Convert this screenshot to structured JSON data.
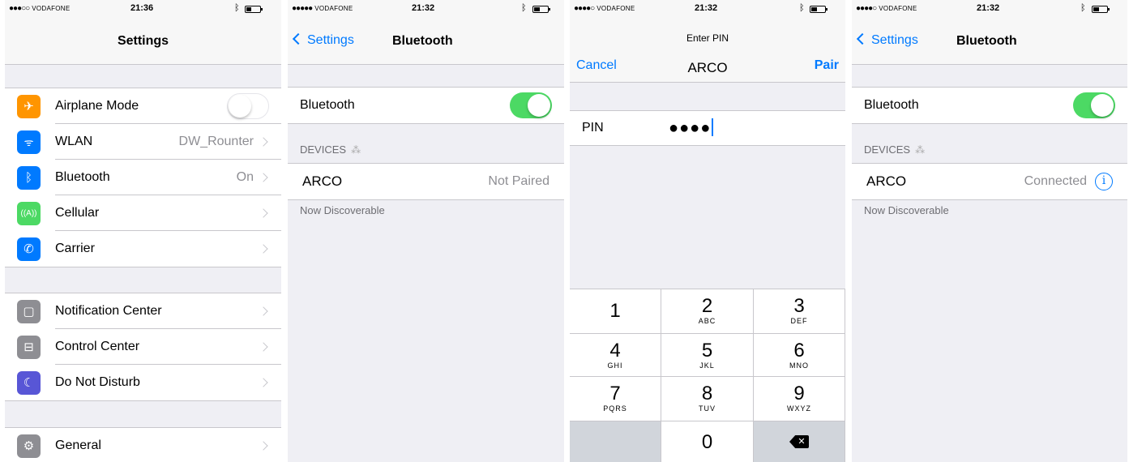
{
  "colors": {
    "accent": "#007aff",
    "toggle_on": "#4cd964",
    "group_bg": "#efeff4"
  },
  "screens": [
    {
      "status": {
        "carrier": "VODAFONE",
        "time": "21:36"
      },
      "nav": {
        "title": "Settings"
      },
      "rows": [
        {
          "label": "Airplane Mode",
          "icon": "airplane-icon",
          "color": "#ff9500",
          "glyph": "✈",
          "toggle": "off"
        },
        {
          "label": "WLAN",
          "icon": "wifi-icon",
          "color": "#007aff",
          "glyph": "≋",
          "value": "DW_Rounter"
        },
        {
          "label": "Bluetooth",
          "icon": "bluetooth-icon",
          "color": "#007aff",
          "glyph": "ᛒ",
          "value": "On"
        },
        {
          "label": "Cellular",
          "icon": "cellular-icon",
          "color": "#4cd964",
          "glyph": "((ᴬ))"
        },
        {
          "label": "Carrier",
          "icon": "phone-icon",
          "color": "#007aff",
          "glyph": "✆"
        },
        {
          "label": "Notification Center",
          "icon": "notification-icon",
          "color": "#8e8e93",
          "glyph": "▢"
        },
        {
          "label": "Control Center",
          "icon": "control-center-icon",
          "color": "#8e8e93",
          "glyph": "⊟"
        },
        {
          "label": "Do Not Disturb",
          "icon": "moon-icon",
          "color": "#5856d6",
          "glyph": "☾"
        },
        {
          "label": "General",
          "icon": "gear-icon",
          "color": "#8e8e93",
          "glyph": "⚙"
        }
      ]
    },
    {
      "status": {
        "carrier": "VODAFONE",
        "time": "21:32"
      },
      "nav": {
        "back": "Settings",
        "title": "Bluetooth"
      },
      "bluetooth_label": "Bluetooth",
      "devices_header": "DEVICES",
      "device": {
        "name": "ARCO",
        "status": "Not Paired"
      },
      "footer": "Now Discoverable"
    },
    {
      "status": {
        "carrier": "VODAFONE",
        "time": "21:32"
      },
      "nav": {
        "subtitle": "Enter PIN",
        "cancel": "Cancel",
        "device": "ARCO",
        "pair": "Pair"
      },
      "pin": {
        "label": "PIN",
        "value": "●●●●"
      },
      "keys": [
        {
          "num": "1",
          "letters": ""
        },
        {
          "num": "2",
          "letters": "ABC"
        },
        {
          "num": "3",
          "letters": "DEF"
        },
        {
          "num": "4",
          "letters": "GHI"
        },
        {
          "num": "5",
          "letters": "JKL"
        },
        {
          "num": "6",
          "letters": "MNO"
        },
        {
          "num": "7",
          "letters": "PQRS"
        },
        {
          "num": "8",
          "letters": "TUV"
        },
        {
          "num": "9",
          "letters": "WXYZ"
        },
        {
          "num": "0",
          "letters": ""
        }
      ]
    },
    {
      "status": {
        "carrier": "VODAFONE",
        "time": "21:32"
      },
      "nav": {
        "back": "Settings",
        "title": "Bluetooth"
      },
      "bluetooth_label": "Bluetooth",
      "devices_header": "DEVICES",
      "device": {
        "name": "ARCO",
        "status": "Connected"
      },
      "footer": "Now Discoverable"
    }
  ]
}
